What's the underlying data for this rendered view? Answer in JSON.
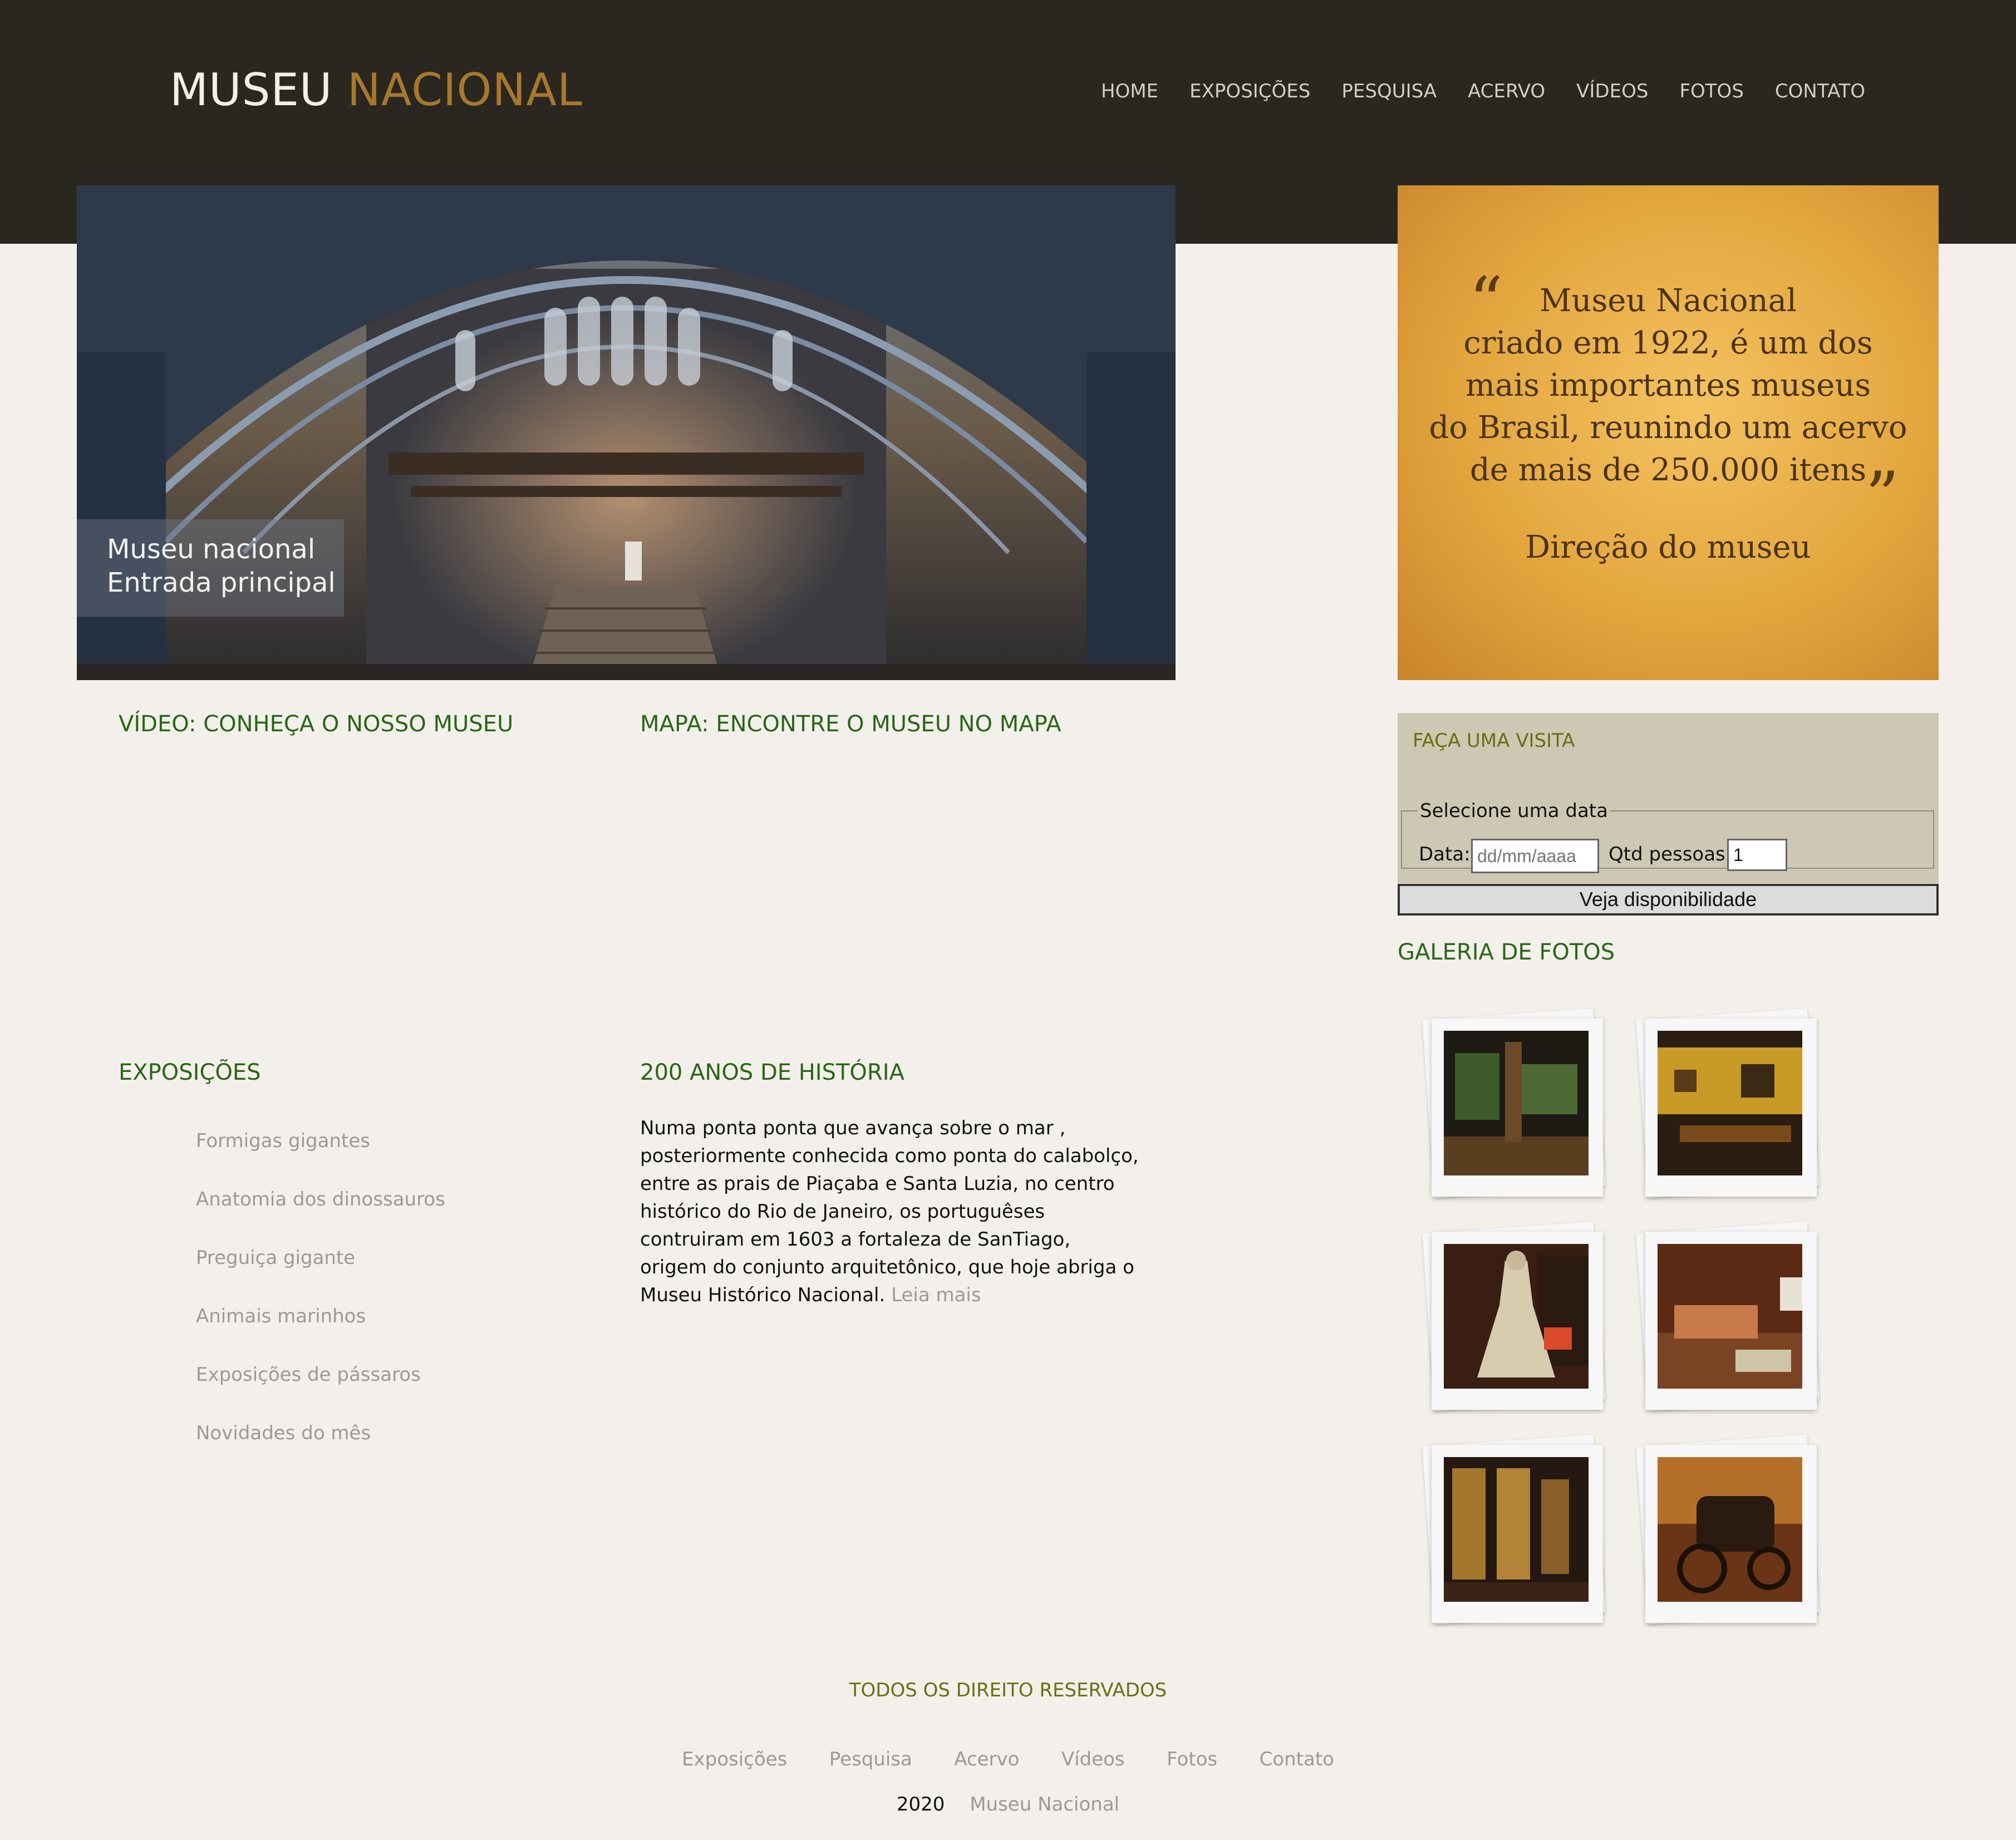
{
  "header": {
    "logo_part1": "MUSEU",
    "logo_part2": "NACIONAL",
    "nav": [
      "HOME",
      "EXPOSIÇÕES",
      "PESQUISA",
      "ACERVO",
      "VÍDEOS",
      "FOTOS",
      "CONTATO"
    ]
  },
  "hero": {
    "caption_line1": "Museu nacional",
    "caption_line2": "Entrada principal"
  },
  "quote": {
    "open_mark": "“",
    "close_mark": "”",
    "lines": [
      "Museu Nacional",
      "criado em 1922, é um dos",
      "mais importantes museus",
      "do Brasil, reunindo um acervo",
      "de mais de 250.000 itens"
    ],
    "signature": "Direção do museu"
  },
  "sections": {
    "video_title": "VÍDEO: CONHEÇA O NOSSO MUSEU",
    "map_title": "MAPA: ENCONTRE O MUSEU NO MAPA",
    "expo_title": "EXPOSIÇÕES",
    "history_title": "200 ANOS DE HISTÓRIA",
    "gallery_title": "GALERIA DE FOTOS"
  },
  "expositions": [
    "Formigas gigantes",
    "Anatomia dos dinossauros",
    "Preguiça gigante",
    "Animais marinhos",
    "Exposições de pássaros",
    "Novidades do mês"
  ],
  "history": {
    "text": "Numa ponta ponta que avança sobre o mar , posteriormente conhecida como ponta do calabolço, entre as prais de Piaçaba e Santa Luzia, no centro histórico do Rio de Janeiro, os portuguêses contruiram em 1603 a fortaleza de SanTiago, origem do conjunto arquitetônico, que hoje abriga o Museu Histórico Nacional.",
    "more_link": "Leia mais"
  },
  "visit": {
    "title": "FAÇA UMA VISITA",
    "legend": "Selecione uma data",
    "date_label": "Data:",
    "date_placeholder": "dd/mm/aaaa",
    "qty_label": "Qtd pessoas:",
    "qty_value": "1",
    "button": "Veja disponibilidade"
  },
  "gallery": {
    "photos": [
      "gallery-hall-green",
      "gallery-hall-yellow",
      "gallery-dress",
      "gallery-exhibit-room",
      "gallery-windows",
      "gallery-carriage"
    ]
  },
  "footer": {
    "title": "TODOS OS DIREITO RESERVADOS",
    "nav": [
      "Exposições",
      "Pesquisa",
      "Acervo",
      "Vídeos",
      "Fotos",
      "Contato"
    ],
    "year": "2020",
    "name": "Museu Nacional"
  },
  "colors": {
    "header_bg": "#2a2720",
    "page_bg": "#f3f0eb",
    "heading_green": "#2a6616",
    "olive": "#6b6e12",
    "logo_accent": "#a8782c",
    "muted_link": "#9c9a96",
    "visit_bg": "#cdc8b3"
  }
}
